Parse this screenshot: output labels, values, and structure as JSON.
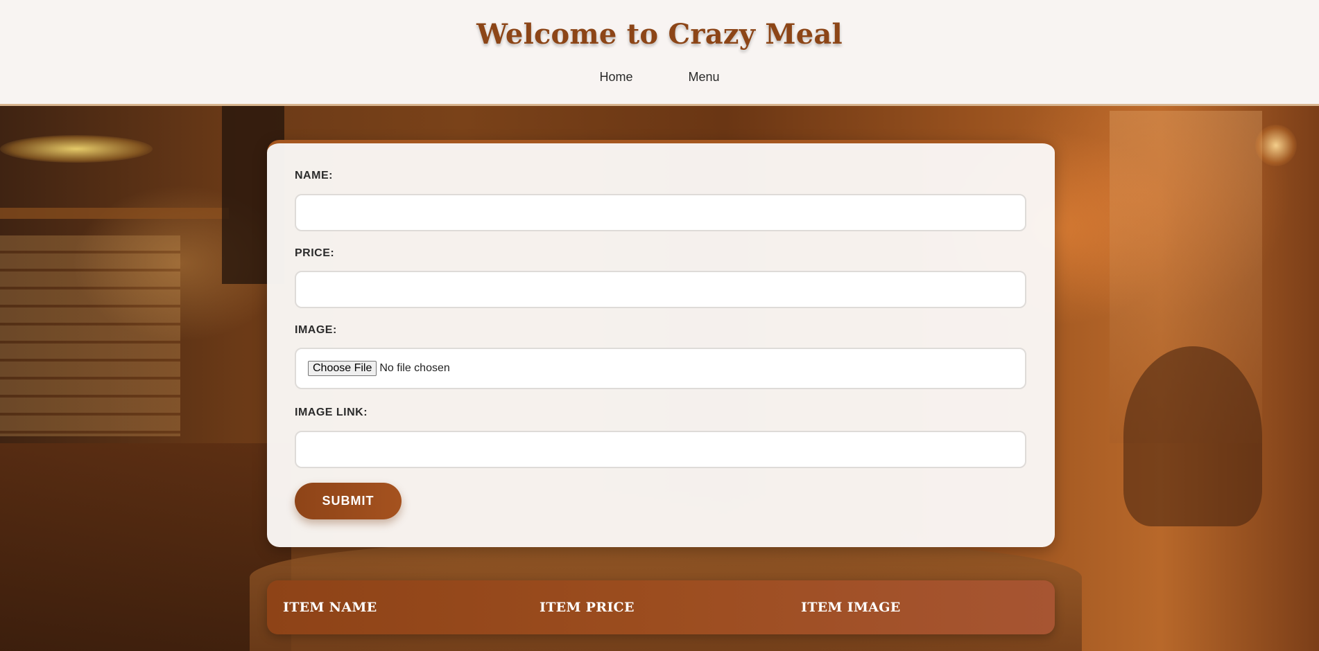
{
  "header": {
    "title": "Welcome to Crazy Meal",
    "nav": [
      {
        "label": "Home"
      },
      {
        "label": "Menu"
      }
    ]
  },
  "form": {
    "name_label": "NAME:",
    "price_label": "PRICE:",
    "image_label": "IMAGE:",
    "image_button": "Choose File",
    "image_status": "No file chosen",
    "image_link_label": "IMAGE LINK:",
    "submit_label": "SUBMIT"
  },
  "table": {
    "columns": [
      "ITEM NAME",
      "ITEM PRICE",
      "ITEM IMAGE"
    ]
  },
  "colors": {
    "accent": "#8c4517",
    "button": "#9a4b1c",
    "header_bg": "#f8f4f2"
  }
}
